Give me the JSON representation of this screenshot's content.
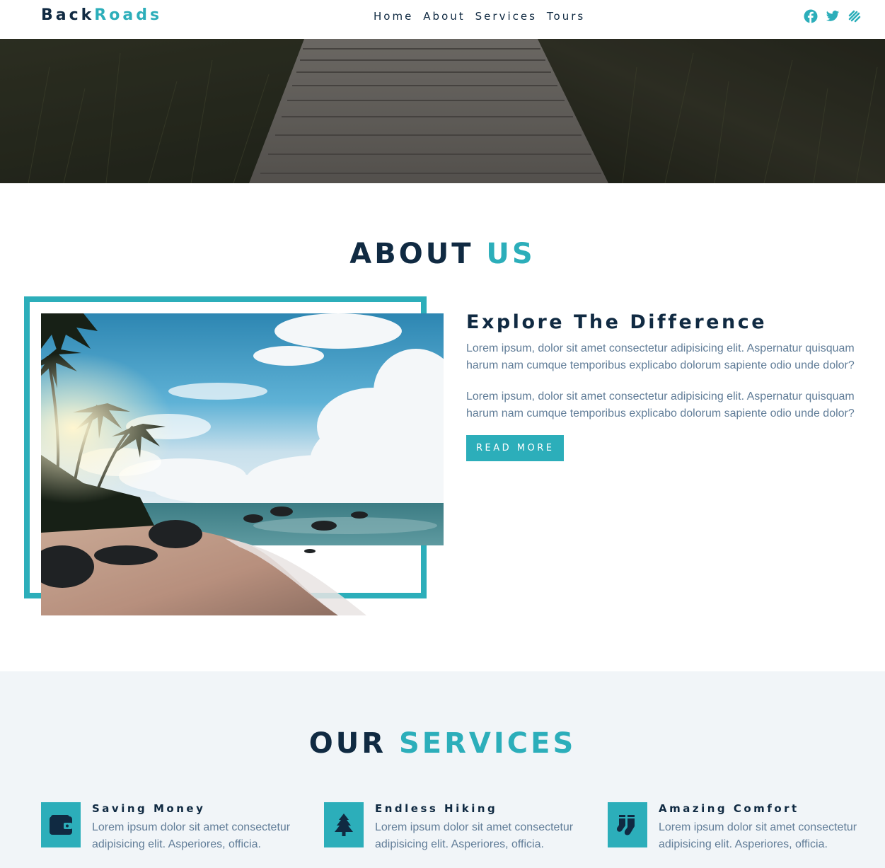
{
  "brand": {
    "name_part1": "Back",
    "name_part2": "Roads"
  },
  "nav": {
    "links": [
      {
        "label": "Home"
      },
      {
        "label": "About"
      },
      {
        "label": "Services"
      },
      {
        "label": "Tours"
      }
    ],
    "social_icons": [
      "facebook-icon",
      "twitter-icon",
      "squarespace-icon"
    ]
  },
  "about": {
    "title_part1": "ABOUT",
    "title_part2": "US",
    "heading": "Explore The Difference",
    "paragraph1": "Lorem ipsum, dolor sit amet consectetur adipisicing elit. Aspernatur quisquam harum nam cumque temporibus explicabo dolorum sapiente odio unde dolor?",
    "paragraph2": "Lorem ipsum, dolor sit amet consectetur adipisicing elit. Aspernatur quisquam harum nam cumque temporibus explicabo dolorum sapiente odio unde dolor?",
    "button_label": "READ MORE"
  },
  "services": {
    "title_part1": "OUR",
    "title_part2": "SERVICES",
    "items": [
      {
        "icon": "wallet-icon",
        "title": "Saving Money",
        "text": "Lorem ipsum dolor sit amet consectetur adipisicing elit. Asperiores, officia."
      },
      {
        "icon": "tree-icon",
        "title": "Endless Hiking",
        "text": "Lorem ipsum dolor sit amet consectetur adipisicing elit. Asperiores, officia."
      },
      {
        "icon": "socks-icon",
        "title": "Amazing Comfort",
        "text": "Lorem ipsum dolor sit amet consectetur adipisicing elit. Asperiores, officia."
      }
    ]
  },
  "colors": {
    "primary": "#2caeba",
    "dark_text": "#102a42",
    "body_text": "#617d98",
    "section_bg": "#f1f5f8"
  }
}
